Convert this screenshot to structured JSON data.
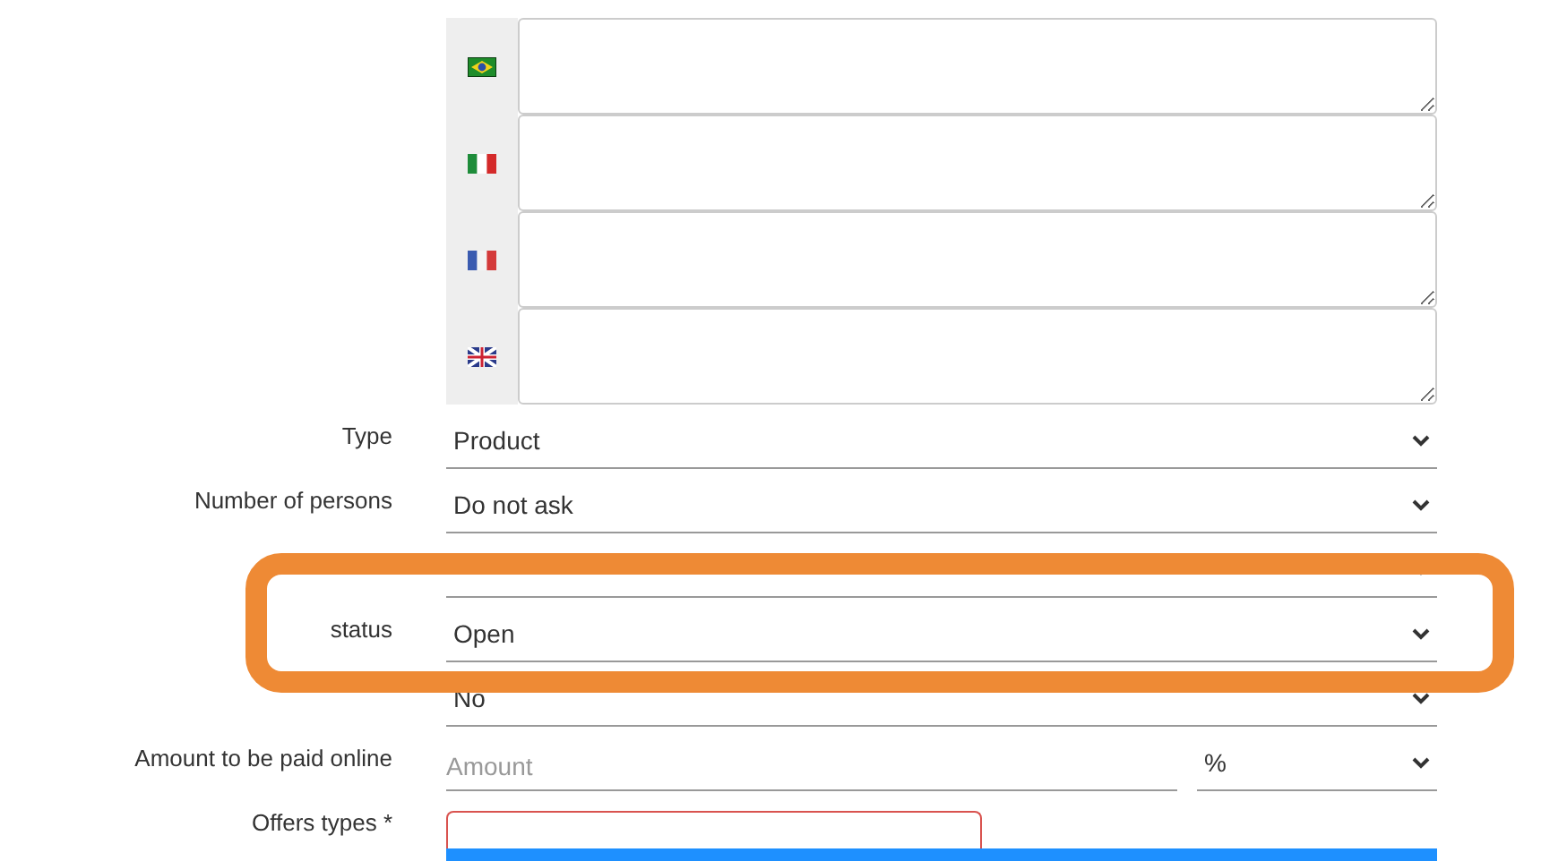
{
  "translations": [
    {
      "kind": "brazil"
    },
    {
      "kind": "italy"
    },
    {
      "kind": "france"
    },
    {
      "kind": "uk"
    }
  ],
  "fields": [
    {
      "kind": "select",
      "label": "Type",
      "value": "Product"
    },
    {
      "kind": "select",
      "label": "Number of persons",
      "value": "Do not ask"
    },
    {
      "kind": "select"
    },
    {
      "kind": "select",
      "label": "status",
      "value": "Open"
    },
    {
      "kind": "select",
      "value": "No"
    },
    {
      "kind": "amount",
      "label": "Amount to be paid online",
      "placeholder": "Amount",
      "unit": "%"
    },
    {
      "kind": "multiselect",
      "label": "Offers types *",
      "options": [
        {
          "selected": true
        }
      ]
    }
  ],
  "annotation": {
    "kind": "rectangle"
  }
}
